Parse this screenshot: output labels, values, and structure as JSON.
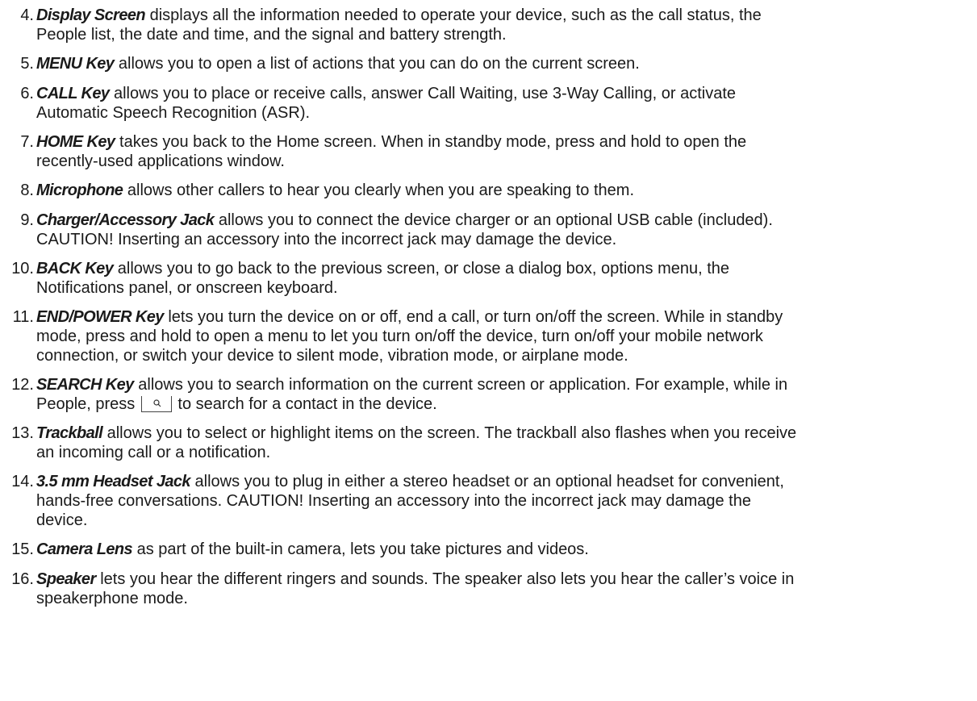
{
  "items": [
    {
      "number": "4.",
      "term": "Display Screen",
      "lines": [
        " displays all the information needed to operate your device, such as the call status, the",
        "People list, the date and time, and the signal and battery strength."
      ]
    },
    {
      "number": "5.",
      "term": "MENU Key",
      "lines": [
        " allows you to open a list of actions that you can do on the current screen."
      ]
    },
    {
      "number": "6.",
      "term": "CALL Key",
      "lines": [
        " allows you to place or receive calls, answer Call Waiting, use 3-Way Calling, or activate",
        "Automatic Speech Recognition (ASR)."
      ]
    },
    {
      "number": "7.",
      "term": "HOME Key",
      "lines": [
        " takes you back to the Home screen. When in standby mode, press and hold to open the",
        "recently-used applications window."
      ]
    },
    {
      "number": "8.",
      "term": "Microphone",
      "lines": [
        " allows other callers to hear you clearly when you are speaking to them."
      ]
    },
    {
      "number": "9.",
      "term": "Charger/Accessory Jack",
      "lines": [
        " allows you to connect the device charger or an optional USB cable (included).",
        "CAUTION! Inserting an accessory into the incorrect jack may damage the device."
      ]
    },
    {
      "number": "10.",
      "term": "BACK Key",
      "lines": [
        " allows you to go back to the previous screen, or close a dialog box, options menu, the",
        "Notifications panel, or onscreen keyboard."
      ]
    },
    {
      "number": "11.",
      "term": "END/POWER Key",
      "lines": [
        " lets you turn the device on or off, end a call, or turn on/off the screen. While in standby",
        "mode, press and hold to open a menu to let you turn on/off the device, turn on/off your mobile network",
        "connection, or switch your device to silent mode, vibration mode, or airplane mode."
      ]
    },
    {
      "number": "12.",
      "term": "SEARCH Key",
      "lines": [
        " allows you to search information on the current screen or application. For example, while in",
        "People, press",
        "to search for a contact in the device."
      ]
    },
    {
      "number": "13.",
      "term": "Trackball",
      "lines": [
        " allows you to select or highlight items on the screen. The trackball also flashes when you receive",
        "an incoming call or a notification."
      ]
    },
    {
      "number": "14.",
      "term": "3.5 mm Headset Jack",
      "lines": [
        " allows you to plug in either a stereo headset or an optional headset for convenient,",
        "hands-free conversations. CAUTION! Inserting an accessory into the incorrect jack may damage the",
        "device."
      ]
    },
    {
      "number": "15.",
      "term": "Camera Lens",
      "lines": [
        " as part of the built-in camera, lets you take pictures and videos."
      ]
    },
    {
      "number": "16.",
      "term": "Speaker",
      "lines": [
        " lets you hear the different ringers and sounds. The speaker also lets you hear the caller’s voice in",
        "speakerphone mode."
      ]
    }
  ],
  "icons": {
    "search_key": "search-icon"
  }
}
